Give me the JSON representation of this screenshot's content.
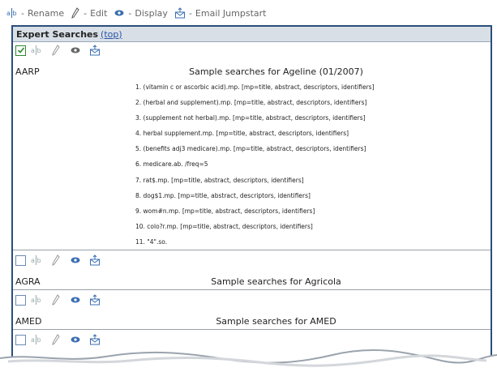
{
  "legend": {
    "rename": "Rename",
    "edit": "Edit",
    "display": "Display",
    "email": "Email Jumpstart"
  },
  "panel": {
    "title": "Expert Searches",
    "top_link": "(top)"
  },
  "entries": [
    {
      "name": "AARP",
      "title": "Sample searches for Ageline (01/2007)",
      "checked": true,
      "searches": [
        "1. (vitamin c or ascorbic acid).mp. [mp=title, abstract, descriptors, identifiers]",
        "2. (herbal and supplement).mp. [mp=title, abstract, descriptors, identifiers]",
        "3. (supplement not herbal).mp. [mp=title, abstract, descriptors, identifiers]",
        "4. herbal supplement.mp. [mp=title, abstract, descriptors, identifiers]",
        "5. (benefits adj3 medicare).mp. [mp=title, abstract, descriptors, identifiers]",
        "6. medicare.ab. /freq=5",
        "7. rat$.mp. [mp=title, abstract, descriptors, identifiers]",
        "8. dog$1.mp. [mp=title, abstract, descriptors, identifiers]",
        "9. wom#n.mp. [mp=title, abstract, descriptors, identifiers]",
        "10. colo?r.mp. [mp=title, abstract, descriptors, identifiers]",
        "11. \"4\".so."
      ]
    },
    {
      "name": "AGRA",
      "title": "Sample searches for Agricola",
      "checked": false
    },
    {
      "name": "AMED",
      "title": "Sample searches for AMED",
      "checked": false
    }
  ],
  "colors": {
    "panel_border": "#2a4f7a",
    "header_bg": "#d9dfe6",
    "link": "#2855a8",
    "check": "#2f8a2f"
  }
}
